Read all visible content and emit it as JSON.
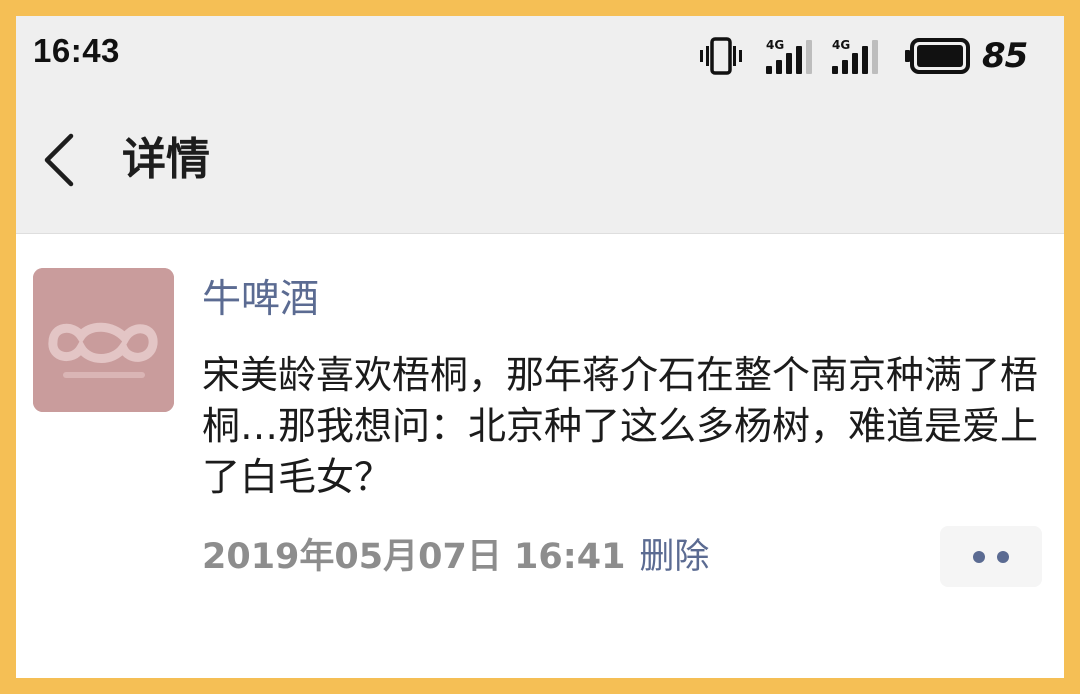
{
  "status_bar": {
    "time": "16:43",
    "network_1": "4G",
    "network_2": "4G",
    "battery_level": "85",
    "icons": [
      "vibrate-icon",
      "signal-4g-icon",
      "signal-4g-icon",
      "battery-icon"
    ]
  },
  "header": {
    "back_icon": "chevron-left-icon",
    "title": "详情"
  },
  "post": {
    "author": "牛啤酒",
    "content": "宋美龄喜欢梧桐，那年蒋介石在整个南京种满了梧桐…那我想问：北京种了这么多杨树，难道是爱上了白毛女？",
    "time": "2019年05月07日 16:41",
    "delete_label": "删除",
    "more_icon": "more-dots-icon"
  },
  "colors": {
    "frame": "#f5bf55",
    "header_bg": "#efefef",
    "link": "#5b6b92",
    "meta_text": "#8d8d8d",
    "avatar": "#c99c9c"
  }
}
